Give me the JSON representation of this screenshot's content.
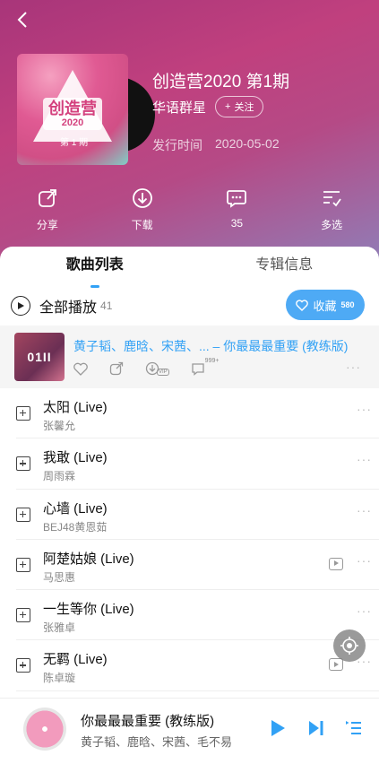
{
  "album": {
    "title": "创造营2020 第1期",
    "artist": "华语群星",
    "follow_label": "关注",
    "release_label": "发行时间",
    "release_date": "2020-05-02",
    "cover_text": "创造营",
    "cover_year": "2020",
    "cover_ep": "第 1 期"
  },
  "actions": [
    {
      "icon": "share-icon",
      "label": "分享"
    },
    {
      "icon": "download-icon",
      "label": "下载"
    },
    {
      "icon": "comment-icon",
      "label": "35"
    },
    {
      "icon": "multi-select-icon",
      "label": "多选"
    }
  ],
  "tabs": [
    "歌曲列表",
    "专辑信息"
  ],
  "play_all": {
    "label": "全部播放",
    "count": "41"
  },
  "collect": {
    "label": "收藏",
    "count": "580"
  },
  "current": {
    "title": "黄子韬、鹿晗、宋茜、...  – 你最最最重要 (教练版)",
    "comment_badge": "999+",
    "vip_badge": "VIP",
    "thumb_text": "01II"
  },
  "songs": [
    {
      "title": "太阳 (Live)",
      "artist": "张馨允",
      "mv": false
    },
    {
      "title": "我敢 (Live)",
      "artist": "周雨霖",
      "mv": false
    },
    {
      "title": "心墙 (Live)",
      "artist": "BEJ48黄恩茹",
      "mv": false
    },
    {
      "title": "阿楚姑娘 (Live)",
      "artist": "马思惠",
      "mv": true
    },
    {
      "title": "一生等你 (Live)",
      "artist": "张雅卓",
      "mv": false
    },
    {
      "title": "无羁 (Live)",
      "artist": "陈卓璇",
      "mv": true
    }
  ],
  "now_playing": {
    "title": "你最最最重要 (教练版)",
    "artist": "黄子韬、鹿晗、宋茜、毛不易"
  },
  "colors": {
    "accent": "#31a1f5",
    "hero_top": "#a8357a",
    "hero_bottom": "#8f7fb8"
  }
}
